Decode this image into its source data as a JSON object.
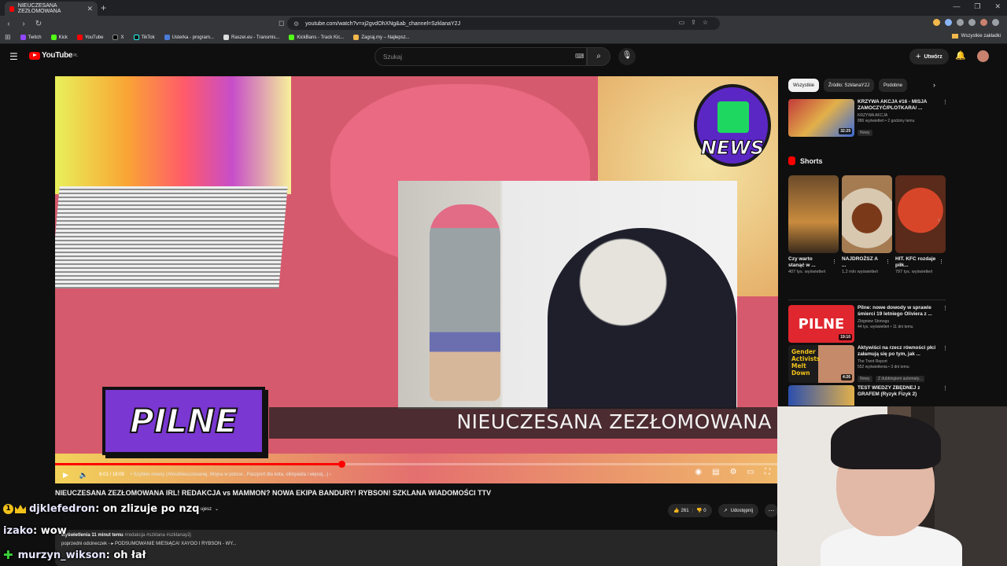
{
  "browser": {
    "tab_title": "NIEUCZESANA ZEZŁOMOWANA",
    "tab_close": "✕",
    "new_tab": "+",
    "url": "youtube.com/watch?v=xj2gvdOhXNg&ab_channel=SzklanaY2J",
    "bookmarks": [
      "Twitch",
      "Kick",
      "YouTube",
      "X",
      "TikTok",
      "Usterka - program...",
      "Raszei.eu - Transmis...",
      "KickBans - Track Kic...",
      "Zagraj.my – Najlepsz..."
    ],
    "all_bookmarks": "Wszystkie zakładki"
  },
  "masthead": {
    "logo": "YouTube",
    "country": "PL",
    "search_placeholder": "Szukaj",
    "create_label": "Utwórz"
  },
  "player": {
    "overlay_headline": "NIEUCZESANA ZEZŁOMOWANA",
    "badge": "PILNE",
    "news_logo": "NEWS",
    "time": "6:01 / 18:09",
    "chapter": "• Szybkie newsy (AferaNieuczesanej, Wojna w polsce , Paszport dla kota, olimpiada i więcej...) ›",
    "progress": 0.396
  },
  "video": {
    "title": "NIEUCZESANA ZEZŁOMOWANA IRL! REDAKCJA vs MAMMON? NOWA EKIPA BANDURY! RYBSON! SZKLANA WIADOMOŚCI TTV",
    "subscribe_label": "ujesz",
    "likes": "261",
    "dislikes": "0",
    "share_label": "Udostępnij",
    "views": "wyświetlenia  11 minut temu",
    "tags": "#redakcja #szklana #szklanay2j",
    "description_line": "poprzedni odcineczek - ▸ PODSUMOWANIE MIESIĄCA! XAYOO I RYBSON - WY..."
  },
  "chat": [
    {
      "user": "djklefedron",
      "message": ": on zlizuje po nzq",
      "badge": "1"
    },
    {
      "user": "izako",
      "message": ": wow"
    },
    {
      "user": "murzyn_wikson",
      "message": ": oh łał"
    }
  ],
  "sidebar": {
    "chips": [
      "Wszystkie",
      "Źródło: SzklanaY2J",
      "Podobne"
    ],
    "top_rec": {
      "title": "KRZYWA AKCJA #16 - MISJA ZAMOCZYĆ/PLOTKARA/ ...",
      "channel": "KRZYWA AKCJA",
      "stats": "886 wyświetleń • 2 godziny temu",
      "tag": "Nowy",
      "duration": "32:29"
    },
    "shorts_title": "Shorts",
    "shorts": [
      {
        "title": "Czy warto stanąć w ...",
        "views": "407 tys. wyświetleń"
      },
      {
        "title": "NAJDROŻSZ A ...",
        "views": "1,2 mln wyświetleń"
      },
      {
        "title": "HIT. KFC rozdaje piłk...",
        "views": "797 tys. wyświetleń"
      }
    ],
    "recs": [
      {
        "title": "Pilne: nowe dowody w sprawie śmierci 19 letniego Oliviera z ...",
        "channel": "Zbigniew Stonoga",
        "stats": "44 tys. wyświetleń • 11 dni temu",
        "duration": "19:10",
        "thumb_text": "PILNE"
      },
      {
        "title": "Aktywiści na rzecz równości płci załamują się po tym, jak ...",
        "channel": "The Trent Report",
        "stats": "552 wyświetlenia • 3 dni temu",
        "tags": [
          "Nowy",
          "Z dubbingiem automaty..."
        ],
        "duration": "4:26",
        "thumb_text": "Gender Activists Melt Down"
      },
      {
        "title": "TEST WIEDZY ZBĘDNEJ z GRAFEM (Ryzyk Fizyk 2)",
        "channel": "",
        "stats": ""
      }
    ]
  },
  "colors": {
    "yt_red": "#ff0000",
    "bg": "#0f0f0f",
    "chip_bg": "#272727",
    "purple": "#7a37d1"
  }
}
